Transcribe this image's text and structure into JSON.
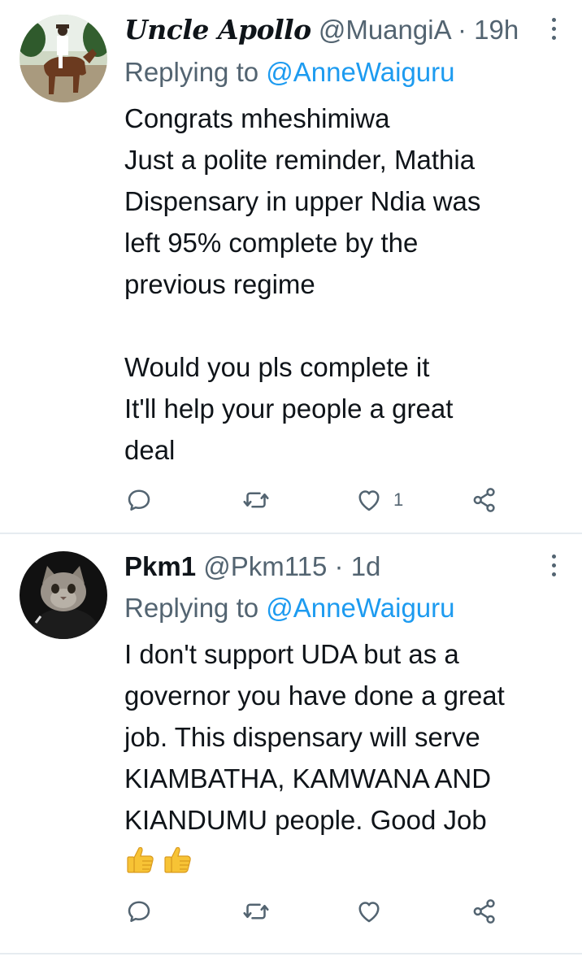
{
  "tweets": [
    {
      "author_name": "Uncle Apollo",
      "handle": "@MuangiA",
      "separator": "·",
      "time": "19h",
      "replying_prefix": "Replying to",
      "replying_to": "@AnneWaiguru",
      "lines": [
        "Congrats mheshimiwa",
        "Just a polite reminder, Mathia",
        "Dispensary in upper Ndia was",
        "left 95% complete by the",
        "previous regime",
        "",
        "Would you pls complete it",
        "It'll help your people a great",
        "deal"
      ],
      "actions": {
        "reply_icon": "reply-icon",
        "retweet_icon": "retweet-icon",
        "like_icon": "heart-icon",
        "like_count": "1",
        "share_icon": "share-icon"
      }
    },
    {
      "author_name": "Pkm1",
      "handle": "@Pkm115",
      "separator": "·",
      "time": "1d",
      "replying_prefix": "Replying to",
      "replying_to": "@AnneWaiguru",
      "lines": [
        "I don't support UDA but as a",
        "governor you have done a great",
        "job. This dispensary will serve",
        "KIAMBATHA, KAMWANA AND",
        "KIANDUMU people. Good Job"
      ],
      "emoji": [
        "thumbs-up",
        "thumbs-up"
      ],
      "actions": {
        "reply_icon": "reply-icon",
        "retweet_icon": "retweet-icon",
        "like_icon": "heart-icon",
        "like_count": "",
        "share_icon": "share-icon"
      }
    }
  ],
  "colors": {
    "text": "#0f1419",
    "secondary": "#536471",
    "link": "#1d9bf0",
    "divider": "#e6ecf0",
    "emoji": "#f7c335"
  }
}
